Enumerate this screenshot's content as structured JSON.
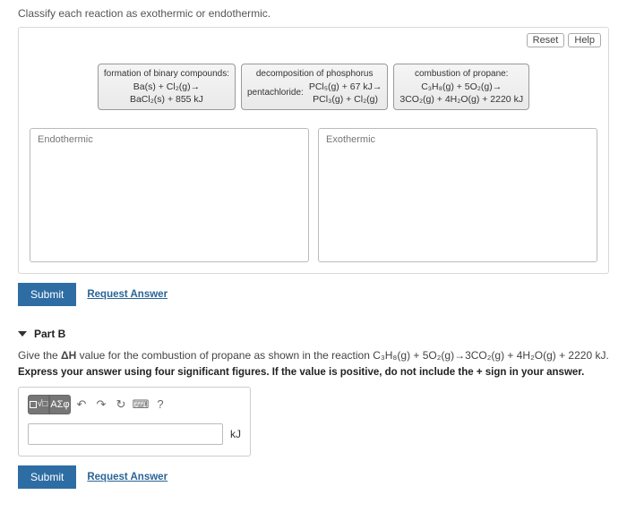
{
  "partA": {
    "prompt": "Classify each reaction as exothermic or endothermic.",
    "reset": "Reset",
    "help": "Help",
    "items": {
      "c1_title": "formation of binary compounds:",
      "c1_l1": "Ba(s) + Cl₂(g)→",
      "c1_l2": "BaCl₂(s) + 855 kJ",
      "c2_title": "decomposition of phosphorus",
      "c2_left": "pentachloride:",
      "c2_r1": "PCl₅(g) + 67 kJ→",
      "c2_r2": "PCl₃(g) + Cl₂(g)",
      "c3_title": "combustion of propane:",
      "c3_l1": "C₃H₈(g) + 5O₂(g)→",
      "c3_l2": "3CO₂(g) + 4H₂O(g) + 2220 kJ"
    },
    "bins": {
      "endo": "Endothermic",
      "exo": "Exothermic"
    },
    "submit": "Submit",
    "request": "Request Answer"
  },
  "partB": {
    "header": "Part B",
    "line_pre": "Give the ",
    "dh": "ΔH",
    "line_mid": " value for the combustion of propane as shown in the reaction ",
    "rxn": "C₃H₈(g) + 5O₂(g)→3CO₂(g) + 4H₂O(g) + 2220 kJ",
    "period": ".",
    "bold": "Express your answer using four significant figures. If the value is positive, do not include the + sign in your answer.",
    "toolbar": {
      "templates_aria": "templates",
      "symbols": "ΑΣφ",
      "undo": "↶",
      "redo": "↷",
      "reset": "↻",
      "keyboard": "⌨",
      "help": "?"
    },
    "unit": "kJ",
    "value": "",
    "placeholder": "",
    "submit": "Submit",
    "request": "Request Answer"
  }
}
